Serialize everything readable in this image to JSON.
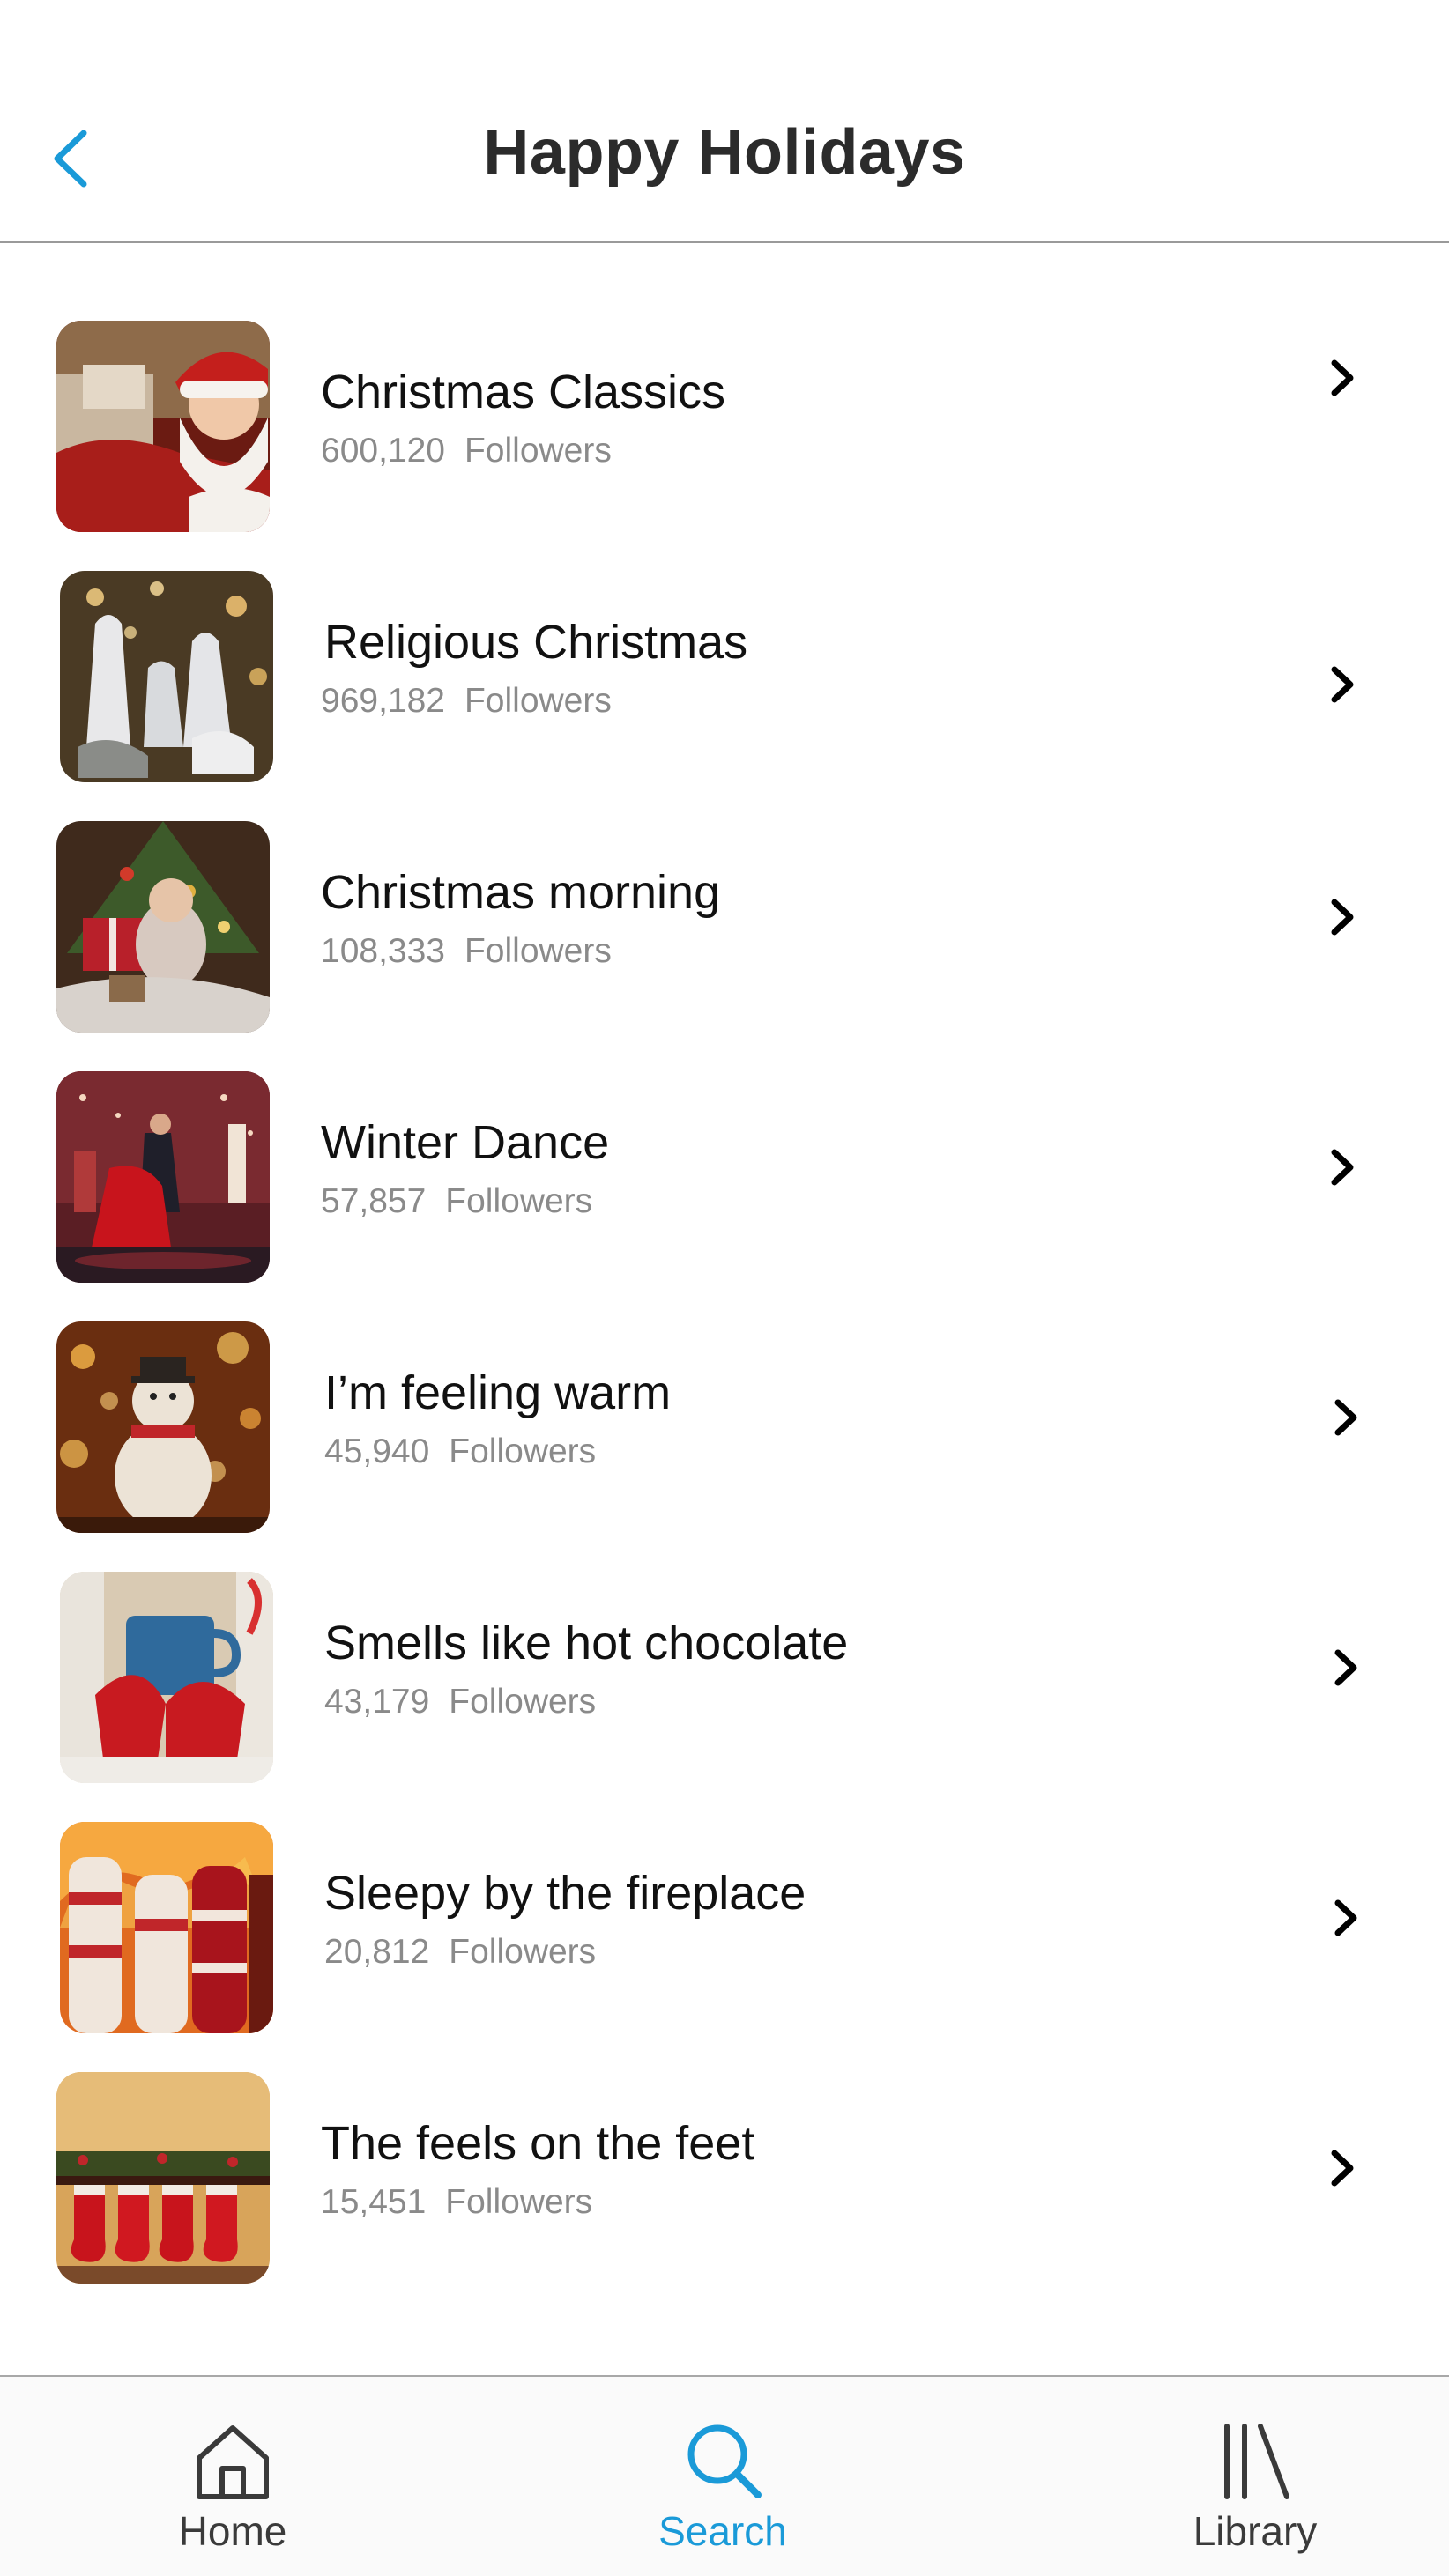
{
  "header": {
    "title": "Happy Holidays",
    "back_icon": "chevron-left-icon"
  },
  "colors": {
    "accent": "#1a9ad8",
    "text_primary": "#111111",
    "text_secondary": "#8a8a8a",
    "tab_inactive": "#3a3a3a"
  },
  "playlists": [
    {
      "title": "Christmas Classics",
      "followers": "600,120",
      "followers_label": "Followers",
      "image": "santa-claus-image"
    },
    {
      "title": "Religious Christmas",
      "followers": "969,182",
      "followers_label": "Followers",
      "image": "nativity-figurines-image"
    },
    {
      "title": "Christmas morning",
      "followers": "108,333",
      "followers_label": "Followers",
      "image": "child-under-tree-image"
    },
    {
      "title": "Winter Dance",
      "followers": "57,857",
      "followers_label": "Followers",
      "image": "dancing-couple-image"
    },
    {
      "title": "I’m feeling warm",
      "followers": "45,940",
      "followers_label": "Followers",
      "image": "snowman-candle-image"
    },
    {
      "title": "Smells like hot chocolate",
      "followers": "43,179",
      "followers_label": "Followers",
      "image": "mug-mittens-image"
    },
    {
      "title": "Sleepy by the fireplace",
      "followers": "20,812",
      "followers_label": "Followers",
      "image": "socks-fireplace-image"
    },
    {
      "title": "The feels on the feet",
      "followers": "15,451",
      "followers_label": "Followers",
      "image": "stockings-mantel-image"
    }
  ],
  "tabbar": {
    "tabs": [
      {
        "label": "Home",
        "icon": "home-icon",
        "active": false
      },
      {
        "label": "Search",
        "icon": "search-icon",
        "active": true
      },
      {
        "label": "Library",
        "icon": "library-icon",
        "active": false
      }
    ]
  }
}
